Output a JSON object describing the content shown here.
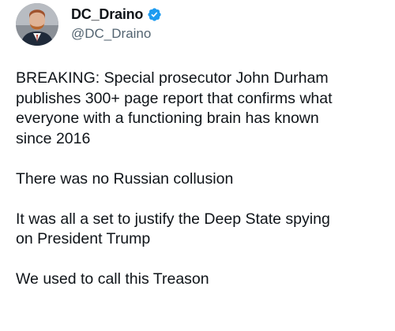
{
  "author": {
    "display_name": "DC_Draino",
    "handle": "@DC_Draino",
    "verified_icon": "verified-badge-icon",
    "verified_color": "#1d9bf0"
  },
  "tweet": {
    "paragraphs": [
      [
        "BREAKING: Special prosecutor John Durham",
        "publishes 300+ page report that confirms what",
        "everyone with a functioning brain has known",
        "since 2016"
      ],
      [
        "There was no Russian collusion"
      ],
      [
        "It was all a set to justify the Deep State spying",
        "on President Trump"
      ],
      [
        "We used to call this Treason"
      ]
    ]
  }
}
